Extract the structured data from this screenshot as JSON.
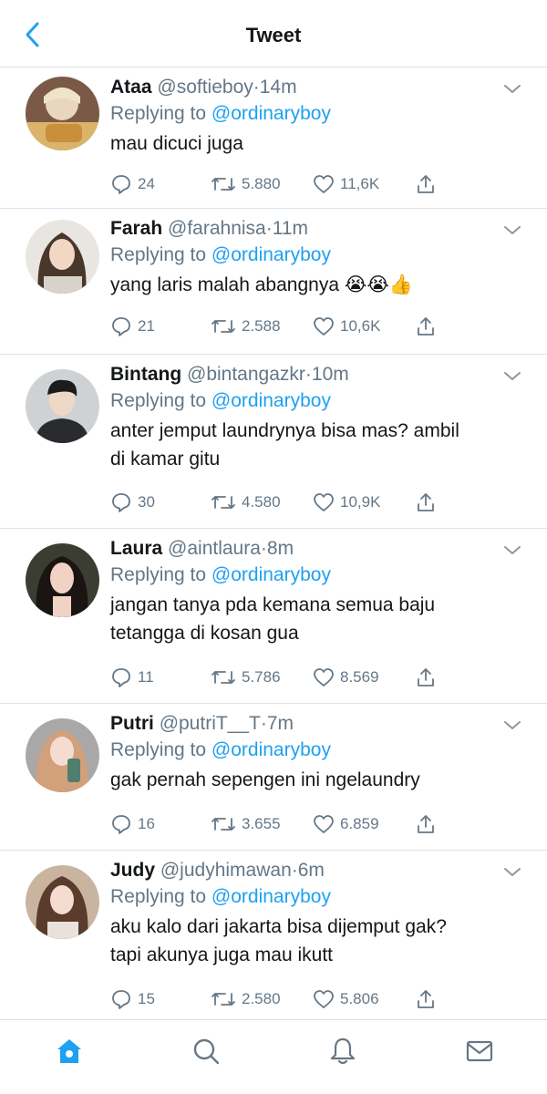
{
  "header": {
    "title": "Tweet",
    "back_icon": "chevron-left-icon"
  },
  "colors": {
    "accent": "#1da1f2",
    "secondary_text": "#657786",
    "primary_text": "#14171a",
    "divider": "#dfe3e6"
  },
  "tweets": [
    {
      "name": "Ataa",
      "handle": "@softieboy",
      "time": "14m",
      "replying_to_prefix": "Replying to ",
      "replying_to": "@ordinaryboy",
      "lines": [
        "mau dicuci juga"
      ],
      "replies": "24",
      "retweets": "5.880",
      "likes": "11,6K"
    },
    {
      "name": "Farah",
      "handle": "@farahnisa",
      "time": "11m",
      "replying_to_prefix": "Replying to ",
      "replying_to": "@ordinaryboy",
      "lines": [
        "yang laris malah abangnya 😭😭👍"
      ],
      "replies": "21",
      "retweets": "2.588",
      "likes": "10,6K"
    },
    {
      "name": "Bintang",
      "handle": "@bintangazkr",
      "time": "10m",
      "replying_to_prefix": "Replying to ",
      "replying_to": "@ordinaryboy",
      "lines": [
        "anter jemput laundrynya bisa mas? ambil",
        "di kamar gitu"
      ],
      "replies": "30",
      "retweets": "4.580",
      "likes": "10,9K"
    },
    {
      "name": "Laura",
      "handle": "@aintlaura",
      "time": "8m",
      "replying_to_prefix": "Replying to ",
      "replying_to": "@ordinaryboy",
      "lines": [
        "jangan tanya pda kemana semua baju",
        "tetangga di kosan gua"
      ],
      "replies": "11",
      "retweets": "5.786",
      "likes": "8.569"
    },
    {
      "name": "Putri",
      "handle": "@putriT__T",
      "time": "7m",
      "replying_to_prefix": "Replying to ",
      "replying_to": "@ordinaryboy",
      "lines": [
        "gak pernah sepengen ini ngelaundry"
      ],
      "replies": "16",
      "retweets": "3.655",
      "likes": "6.859"
    },
    {
      "name": "Judy",
      "handle": "@judyhimawan",
      "time": "6m",
      "replying_to_prefix": "Replying to ",
      "replying_to": "@ordinaryboy",
      "lines": [
        "aku kalo dari jakarta bisa dijemput gak?",
        "tapi akunya juga mau ikutt"
      ],
      "replies": "15",
      "retweets": "2.580",
      "likes": "5.806"
    }
  ],
  "tabbar": {
    "items": [
      "home-icon",
      "search-icon",
      "notifications-icon",
      "messages-icon"
    ]
  }
}
